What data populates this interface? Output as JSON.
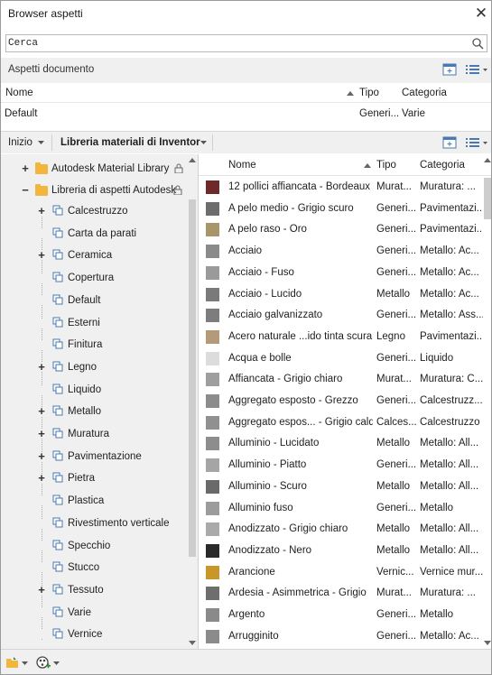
{
  "window": {
    "title": "Browser aspetti"
  },
  "search": {
    "placeholder": "Cerca"
  },
  "document_section": {
    "title": "Aspetti documento",
    "columns": {
      "name": "Nome",
      "type": "Tipo",
      "category": "Categoria"
    },
    "rows": [
      {
        "name": "Default",
        "type": "Generi...",
        "category": "Varie"
      }
    ]
  },
  "breadcrumb": {
    "home": "Inizio",
    "library": "Libreria materiali di Inventor"
  },
  "tree": {
    "libraries": [
      {
        "label": "Autodesk Material Library",
        "expander": "+"
      },
      {
        "label": "Libreria di aspetti Autodesk",
        "expander": "−"
      }
    ],
    "categories": [
      {
        "label": "Calcestruzzo",
        "expander": "+"
      },
      {
        "label": "Carta da parati",
        "expander": ""
      },
      {
        "label": "Ceramica",
        "expander": "+"
      },
      {
        "label": "Copertura",
        "expander": ""
      },
      {
        "label": "Default",
        "expander": ""
      },
      {
        "label": "Esterni",
        "expander": ""
      },
      {
        "label": "Finitura",
        "expander": ""
      },
      {
        "label": "Legno",
        "expander": "+"
      },
      {
        "label": "Liquido",
        "expander": ""
      },
      {
        "label": "Metallo",
        "expander": "+"
      },
      {
        "label": "Muratura",
        "expander": "+"
      },
      {
        "label": "Pavimentazione",
        "expander": "+"
      },
      {
        "label": "Pietra",
        "expander": "+"
      },
      {
        "label": "Plastica",
        "expander": ""
      },
      {
        "label": "Rivestimento verticale",
        "expander": ""
      },
      {
        "label": "Specchio",
        "expander": ""
      },
      {
        "label": "Stucco",
        "expander": ""
      },
      {
        "label": "Tessuto",
        "expander": "+"
      },
      {
        "label": "Varie",
        "expander": ""
      },
      {
        "label": "Vernice",
        "expander": ""
      }
    ]
  },
  "list": {
    "columns": {
      "name": "Nome",
      "type": "Tipo",
      "category": "Categoria"
    },
    "rows": [
      {
        "name": "12 pollici affiancata - Bordeaux",
        "type": "Murat...",
        "category": "Muratura: ...",
        "swatch": "#6e2a2a"
      },
      {
        "name": "A pelo medio - Grigio scuro",
        "type": "Generi...",
        "category": "Pavimentazi...",
        "swatch": "#6d6d6d"
      },
      {
        "name": "A pelo raso - Oro",
        "type": "Generi...",
        "category": "Pavimentazi...",
        "swatch": "#a8966a"
      },
      {
        "name": "Acciaio",
        "type": "Generi...",
        "category": "Metallo: Ac...",
        "swatch": "#8a8a8a"
      },
      {
        "name": "Acciaio - Fuso",
        "type": "Generi...",
        "category": "Metallo: Ac...",
        "swatch": "#9a9a9a"
      },
      {
        "name": "Acciaio - Lucido",
        "type": "Metallo",
        "category": "Metallo: Ac...",
        "swatch": "#7a7a7a"
      },
      {
        "name": "Acciaio galvanizzato",
        "type": "Generi...",
        "category": "Metallo: Ass...",
        "swatch": "#7d7d7d"
      },
      {
        "name": "Acero naturale ...ido tinta scura",
        "type": "Legno",
        "category": "Pavimentazi...",
        "swatch": "#b49a78"
      },
      {
        "name": "Acqua e bolle",
        "type": "Generi...",
        "category": "Liquido",
        "swatch": "#dcdcdc"
      },
      {
        "name": "Affiancata - Grigio chiaro",
        "type": "Murat...",
        "category": "Muratura: C...",
        "swatch": "#9e9e9e"
      },
      {
        "name": "Aggregato esposto - Grezzo",
        "type": "Generi...",
        "category": "Calcestruzz...",
        "swatch": "#8c8c8c"
      },
      {
        "name": "Aggregato espos... - Grigio caldo",
        "type": "Calces...",
        "category": "Calcestruzzo",
        "swatch": "#909090"
      },
      {
        "name": "Alluminio - Lucidato",
        "type": "Metallo",
        "category": "Metallo: All...",
        "swatch": "#8d8d8d"
      },
      {
        "name": "Alluminio - Piatto",
        "type": "Generi...",
        "category": "Metallo: All...",
        "swatch": "#a5a5a5"
      },
      {
        "name": "Alluminio - Scuro",
        "type": "Metallo",
        "category": "Metallo: All...",
        "swatch": "#6a6a6a"
      },
      {
        "name": "Alluminio fuso",
        "type": "Generi...",
        "category": "Metallo",
        "swatch": "#9c9c9c"
      },
      {
        "name": "Anodizzato - Grigio chiaro",
        "type": "Metallo",
        "category": "Metallo: All...",
        "swatch": "#aaaaaa"
      },
      {
        "name": "Anodizzato - Nero",
        "type": "Metallo",
        "category": "Metallo: All...",
        "swatch": "#2a2a2a"
      },
      {
        "name": "Arancione",
        "type": "Vernic...",
        "category": "Vernice mur...",
        "swatch": "#c9962a"
      },
      {
        "name": "Ardesia - Asimmetrica - Grigio",
        "type": "Murat...",
        "category": "Muratura: ...",
        "swatch": "#6e6e6e"
      },
      {
        "name": "Argento",
        "type": "Generi...",
        "category": "Metallo",
        "swatch": "#8a8a8a"
      },
      {
        "name": "Arrugginito",
        "type": "Generi...",
        "category": "Metallo: Ac...",
        "swatch": "#8b8b8b"
      }
    ]
  }
}
